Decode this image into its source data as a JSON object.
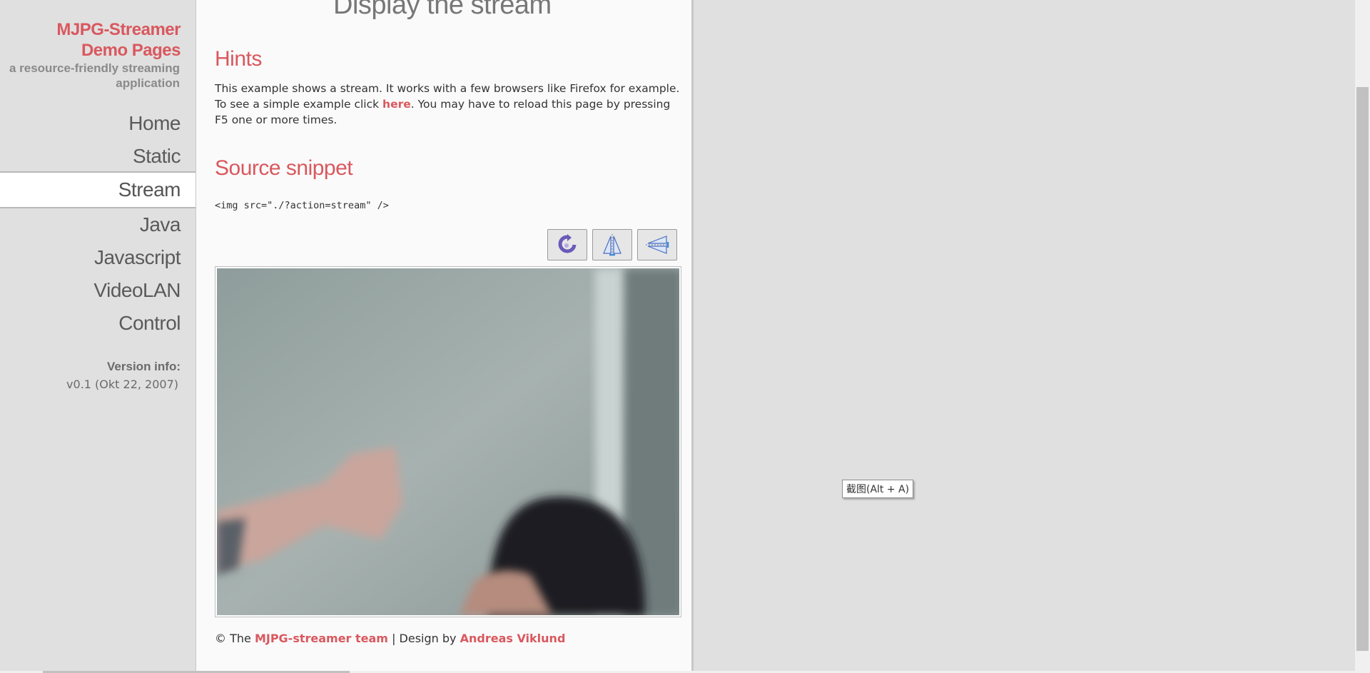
{
  "sidebar": {
    "brand_line1": "MJPG-Streamer",
    "brand_line2": "Demo Pages",
    "tagline_line1": "a resource-friendly streaming",
    "tagline_line2": "application",
    "nav": [
      {
        "label": "Home"
      },
      {
        "label": "Static"
      },
      {
        "label": "Stream",
        "active": true
      },
      {
        "label": "Java"
      },
      {
        "label": "Javascript"
      },
      {
        "label": "VideoLAN"
      },
      {
        "label": "Control"
      }
    ],
    "version_label": "Version info:",
    "version_value": "v0.1 (Okt 22, 2007)"
  },
  "main": {
    "page_title": "Display the stream",
    "hints": {
      "heading": "Hints",
      "text_before": "This example shows a stream. It works with a few browsers like Firefox for example. To see a simple example click ",
      "link": "here",
      "text_after": ". You may have to reload this page by pressing F5 one or more times."
    },
    "snippet": {
      "heading": "Source snippet",
      "code": "<img src=\"./?action=stream\" />"
    },
    "toolbar": {
      "buttons": [
        {
          "icon": "rotate-icon"
        },
        {
          "icon": "flip-vertical-icon"
        },
        {
          "icon": "flip-horizontal-icon"
        }
      ]
    },
    "footer": {
      "prefix": "© The ",
      "team_link": "MJPG-streamer team",
      "middle": " | Design by ",
      "designer_link": "Andreas Viklund"
    }
  },
  "tooltip": "截图(Alt + A)",
  "colors": {
    "accent": "#d9585e",
    "sidebar_bg": "#e0e0e0",
    "content_bg": "#fafafa"
  }
}
